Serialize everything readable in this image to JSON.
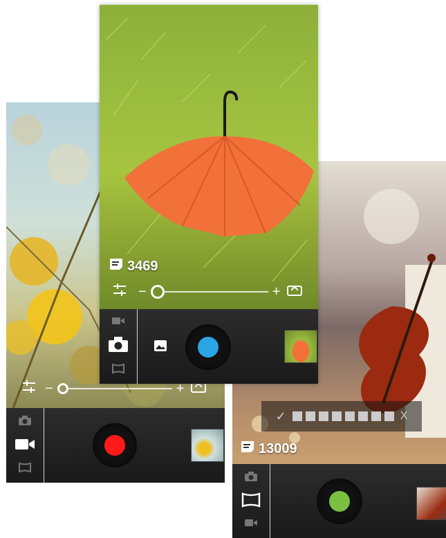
{
  "screens": {
    "video": {
      "mode": "video",
      "shutter_color": "#ff1a1a",
      "zoom": {
        "minus": "−",
        "plus": "+"
      }
    },
    "photo": {
      "mode": "photo",
      "shot_count": "3469",
      "shutter_color": "#2aa6e4",
      "zoom": {
        "minus": "−",
        "plus": "+"
      }
    },
    "panorama": {
      "mode": "panorama",
      "shot_count": "13009",
      "shutter_color": "#7ac142",
      "panorama_frames": 8,
      "panorama_check": "✓",
      "panorama_cancel": "X"
    }
  },
  "icons": [
    "camera-icon",
    "video-camera-icon",
    "panorama-icon",
    "gallery-icon",
    "settings-sliders-icon",
    "switch-camera-icon",
    "storage-icon",
    "check-icon",
    "close-icon"
  ]
}
